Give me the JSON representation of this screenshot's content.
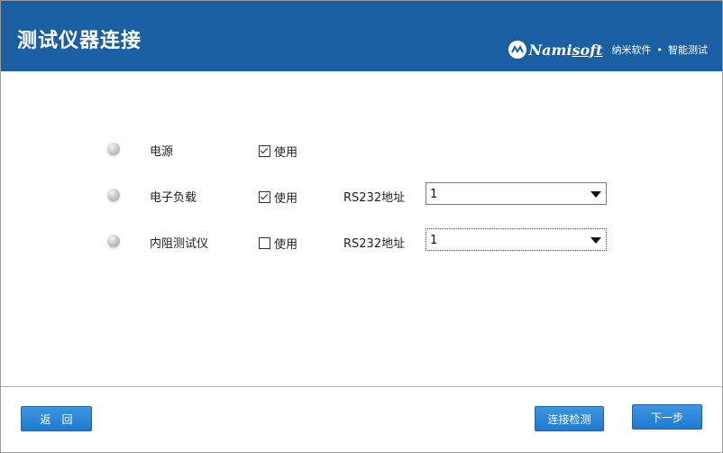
{
  "header": {
    "title": "测试仪器连接",
    "brand": {
      "name_main": "Nami",
      "name_soft": "soft",
      "tag1": "纳米软件",
      "dot": "•",
      "tag2": "智能测试"
    }
  },
  "devices": [
    {
      "name": "电源",
      "use_label": "使用",
      "checked": true,
      "show_address": false
    },
    {
      "name": "电子负载",
      "use_label": "使用",
      "checked": true,
      "show_address": true,
      "address_label": "RS232地址",
      "address_value": "1"
    },
    {
      "name": "内阻测试仪",
      "use_label": "使用",
      "checked": false,
      "show_address": true,
      "address_label": "RS232地址",
      "address_value": "1"
    }
  ],
  "footer": {
    "back_label": "返回",
    "check_label": "连接检测",
    "next_label": "下一步"
  },
  "colors": {
    "header_bg": "#1a5fa3",
    "button_bg": "#2b87d9"
  }
}
